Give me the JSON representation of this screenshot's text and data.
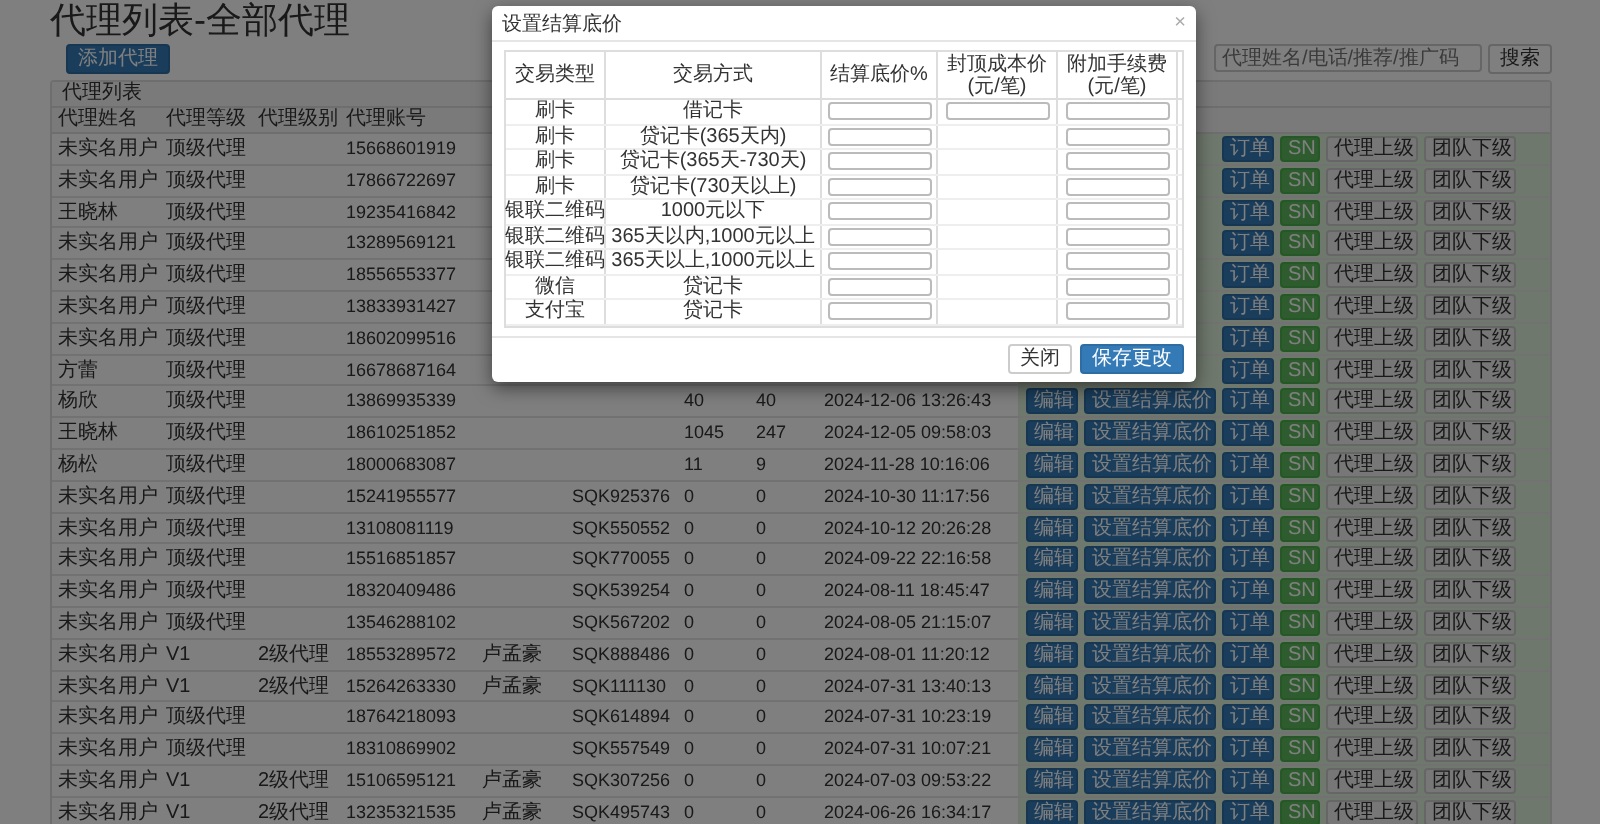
{
  "page": {
    "title": "代理列表-全部代理",
    "add_button": "添加代理",
    "search": {
      "placeholder": "代理姓名/电话/推荐/推广码"
    },
    "search_button": "搜索"
  },
  "panel": {
    "heading": "代理列表",
    "columns": [
      "代理姓名",
      "代理等级",
      "代理级别",
      "代理账号"
    ],
    "rows": [
      {
        "name": "未实名用户",
        "level": "顶级代理",
        "phone": "15668601919",
        "actions": [
          {
            "kind": "order",
            "label": "订单"
          },
          {
            "kind": "sn",
            "label": "SN"
          },
          {
            "kind": "upline",
            "label": "代理上级"
          },
          {
            "kind": "downline",
            "label": "团队下级"
          }
        ]
      },
      {
        "name": "未实名用户",
        "level": "顶级代理",
        "phone": "17866722697",
        "actions": [
          {
            "kind": "order",
            "label": "订单"
          },
          {
            "kind": "sn",
            "label": "SN"
          },
          {
            "kind": "upline",
            "label": "代理上级"
          },
          {
            "kind": "downline",
            "label": "团队下级"
          }
        ]
      },
      {
        "name": "王晓林",
        "level": "顶级代理",
        "phone": "19235416842",
        "actions": [
          {
            "kind": "order",
            "label": "订单"
          },
          {
            "kind": "sn",
            "label": "SN"
          },
          {
            "kind": "upline",
            "label": "代理上级"
          },
          {
            "kind": "downline",
            "label": "团队下级"
          }
        ]
      },
      {
        "name": "未实名用户",
        "level": "顶级代理",
        "phone": "13289569121",
        "actions": [
          {
            "kind": "order",
            "label": "订单"
          },
          {
            "kind": "sn",
            "label": "SN"
          },
          {
            "kind": "upline",
            "label": "代理上级"
          },
          {
            "kind": "downline",
            "label": "团队下级"
          }
        ]
      },
      {
        "name": "未实名用户",
        "level": "顶级代理",
        "phone": "18556553377",
        "actions": [
          {
            "kind": "order",
            "label": "订单"
          },
          {
            "kind": "sn",
            "label": "SN"
          },
          {
            "kind": "upline",
            "label": "代理上级"
          },
          {
            "kind": "downline",
            "label": "团队下级"
          }
        ]
      },
      {
        "name": "未实名用户",
        "level": "顶级代理",
        "phone": "13833931427",
        "actions": [
          {
            "kind": "order",
            "label": "订单"
          },
          {
            "kind": "sn",
            "label": "SN"
          },
          {
            "kind": "upline",
            "label": "代理上级"
          },
          {
            "kind": "downline",
            "label": "团队下级"
          }
        ]
      },
      {
        "name": "未实名用户",
        "level": "顶级代理",
        "phone": "18602099516",
        "actions": [
          {
            "kind": "order",
            "label": "订单"
          },
          {
            "kind": "sn",
            "label": "SN"
          },
          {
            "kind": "upline",
            "label": "代理上级"
          },
          {
            "kind": "downline",
            "label": "团队下级"
          }
        ]
      },
      {
        "name": "方蕾",
        "level": "顶级代理",
        "phone": "16678687164",
        "actions": [
          {
            "kind": "order",
            "label": "订单"
          },
          {
            "kind": "sn",
            "label": "SN"
          },
          {
            "kind": "upline",
            "label": "代理上级"
          },
          {
            "kind": "downline",
            "label": "团队下级"
          }
        ]
      },
      {
        "name": "杨欣",
        "level": "顶级代理",
        "phone": "13869935339",
        "column_7": "40",
        "column_8": "40",
        "column_9": "2024-12-06 13:26:43",
        "actions": [
          {
            "kind": "edit",
            "label": "编辑"
          },
          {
            "kind": "price",
            "label": "设置结算底价"
          },
          {
            "kind": "order",
            "label": "订单"
          },
          {
            "kind": "sn",
            "label": "SN"
          },
          {
            "kind": "upline",
            "label": "代理上级"
          },
          {
            "kind": "downline",
            "label": "团队下级"
          }
        ]
      },
      {
        "name": "王晓林",
        "level": "顶级代理",
        "phone": "18610251852",
        "column_7": "1045",
        "column_8": "247",
        "column_9": "2024-12-05 09:58:03",
        "actions": [
          {
            "kind": "edit",
            "label": "编辑"
          },
          {
            "kind": "price",
            "label": "设置结算底价"
          },
          {
            "kind": "order",
            "label": "订单"
          },
          {
            "kind": "sn",
            "label": "SN"
          },
          {
            "kind": "upline",
            "label": "代理上级"
          },
          {
            "kind": "downline",
            "label": "团队下级"
          }
        ]
      },
      {
        "name": "杨松",
        "level": "顶级代理",
        "phone": "18000683087",
        "column_7": "11",
        "column_8": "9",
        "column_9": "2024-11-28 10:16:06",
        "actions": [
          {
            "kind": "edit",
            "label": "编辑"
          },
          {
            "kind": "price",
            "label": "设置结算底价"
          },
          {
            "kind": "order",
            "label": "订单"
          },
          {
            "kind": "sn",
            "label": "SN"
          },
          {
            "kind": "upline",
            "label": "代理上级"
          },
          {
            "kind": "downline",
            "label": "团队下级"
          }
        ]
      },
      {
        "name": "未实名用户",
        "level": "顶级代理",
        "phone": "15241955577",
        "column_6": "SQK925376",
        "column_7": "0",
        "column_8": "0",
        "column_9": "2024-10-30 11:17:56",
        "actions": [
          {
            "kind": "edit",
            "label": "编辑"
          },
          {
            "kind": "price",
            "label": "设置结算底价"
          },
          {
            "kind": "order",
            "label": "订单"
          },
          {
            "kind": "sn",
            "label": "SN"
          },
          {
            "kind": "upline",
            "label": "代理上级"
          },
          {
            "kind": "downline",
            "label": "团队下级"
          }
        ]
      },
      {
        "name": "未实名用户",
        "level": "顶级代理",
        "phone": "13108081119",
        "column_6": "SQK550552",
        "column_7": "0",
        "column_8": "0",
        "column_9": "2024-10-12 20:26:28",
        "actions": [
          {
            "kind": "edit",
            "label": "编辑"
          },
          {
            "kind": "price",
            "label": "设置结算底价"
          },
          {
            "kind": "order",
            "label": "订单"
          },
          {
            "kind": "sn",
            "label": "SN"
          },
          {
            "kind": "upline",
            "label": "代理上级"
          },
          {
            "kind": "downline",
            "label": "团队下级"
          }
        ]
      },
      {
        "name": "未实名用户",
        "level": "顶级代理",
        "phone": "15516851857",
        "column_6": "SQK770055",
        "column_7": "0",
        "column_8": "0",
        "column_9": "2024-09-22 22:16:58",
        "actions": [
          {
            "kind": "edit",
            "label": "编辑"
          },
          {
            "kind": "price",
            "label": "设置结算底价"
          },
          {
            "kind": "order",
            "label": "订单"
          },
          {
            "kind": "sn",
            "label": "SN"
          },
          {
            "kind": "upline",
            "label": "代理上级"
          },
          {
            "kind": "downline",
            "label": "团队下级"
          }
        ]
      },
      {
        "name": "未实名用户",
        "level": "顶级代理",
        "phone": "18320409486",
        "column_6": "SQK539254",
        "column_7": "0",
        "column_8": "0",
        "column_9": "2024-08-11 18:45:47",
        "actions": [
          {
            "kind": "edit",
            "label": "编辑"
          },
          {
            "kind": "price",
            "label": "设置结算底价"
          },
          {
            "kind": "order",
            "label": "订单"
          },
          {
            "kind": "sn",
            "label": "SN"
          },
          {
            "kind": "upline",
            "label": "代理上级"
          },
          {
            "kind": "downline",
            "label": "团队下级"
          }
        ]
      },
      {
        "name": "未实名用户",
        "level": "顶级代理",
        "phone": "13546288102",
        "column_6": "SQK567202",
        "column_7": "0",
        "column_8": "0",
        "column_9": "2024-08-05 21:15:07",
        "actions": [
          {
            "kind": "edit",
            "label": "编辑"
          },
          {
            "kind": "price",
            "label": "设置结算底价"
          },
          {
            "kind": "order",
            "label": "订单"
          },
          {
            "kind": "sn",
            "label": "SN"
          },
          {
            "kind": "upline",
            "label": "代理上级"
          },
          {
            "kind": "downline",
            "label": "团队下级"
          }
        ]
      },
      {
        "name": "未实名用户",
        "level": "V1",
        "tier": "2级代理",
        "phone": "18553289572",
        "column_5": "卢孟豪",
        "column_6": "SQK888486",
        "column_7": "0",
        "column_8": "0",
        "column_9": "2024-08-01 11:20:12",
        "actions": [
          {
            "kind": "edit",
            "label": "编辑"
          },
          {
            "kind": "price",
            "label": "设置结算底价"
          },
          {
            "kind": "order",
            "label": "订单"
          },
          {
            "kind": "sn",
            "label": "SN"
          },
          {
            "kind": "upline",
            "label": "代理上级"
          },
          {
            "kind": "downline",
            "label": "团队下级"
          }
        ]
      },
      {
        "name": "未实名用户",
        "level": "V1",
        "tier": "2级代理",
        "phone": "15264263330",
        "column_5": "卢孟豪",
        "column_6": "SQK111130",
        "column_7": "0",
        "column_8": "0",
        "column_9": "2024-07-31 13:40:13",
        "actions": [
          {
            "kind": "edit",
            "label": "编辑"
          },
          {
            "kind": "price",
            "label": "设置结算底价"
          },
          {
            "kind": "order",
            "label": "订单"
          },
          {
            "kind": "sn",
            "label": "SN"
          },
          {
            "kind": "upline",
            "label": "代理上级"
          },
          {
            "kind": "downline",
            "label": "团队下级"
          }
        ]
      },
      {
        "name": "未实名用户",
        "level": "顶级代理",
        "phone": "18764218093",
        "column_6": "SQK614894",
        "column_7": "0",
        "column_8": "0",
        "column_9": "2024-07-31 10:23:19",
        "actions": [
          {
            "kind": "edit",
            "label": "编辑"
          },
          {
            "kind": "price",
            "label": "设置结算底价"
          },
          {
            "kind": "order",
            "label": "订单"
          },
          {
            "kind": "sn",
            "label": "SN"
          },
          {
            "kind": "upline",
            "label": "代理上级"
          },
          {
            "kind": "downline",
            "label": "团队下级"
          }
        ]
      },
      {
        "name": "未实名用户",
        "level": "顶级代理",
        "phone": "18310869902",
        "column_6": "SQK557549",
        "column_7": "0",
        "column_8": "0",
        "column_9": "2024-07-31 10:07:21",
        "actions": [
          {
            "kind": "edit",
            "label": "编辑"
          },
          {
            "kind": "price",
            "label": "设置结算底价"
          },
          {
            "kind": "order",
            "label": "订单"
          },
          {
            "kind": "sn",
            "label": "SN"
          },
          {
            "kind": "upline",
            "label": "代理上级"
          },
          {
            "kind": "downline",
            "label": "团队下级"
          }
        ]
      },
      {
        "name": "未实名用户",
        "level": "V1",
        "tier": "2级代理",
        "phone": "15106595121",
        "column_5": "卢孟豪",
        "column_6": "SQK307256",
        "column_7": "0",
        "column_8": "0",
        "column_9": "2024-07-03 09:53:22",
        "actions": [
          {
            "kind": "edit",
            "label": "编辑"
          },
          {
            "kind": "price",
            "label": "设置结算底价"
          },
          {
            "kind": "order",
            "label": "订单"
          },
          {
            "kind": "sn",
            "label": "SN"
          },
          {
            "kind": "upline",
            "label": "代理上级"
          },
          {
            "kind": "downline",
            "label": "团队下级"
          }
        ]
      },
      {
        "name": "未实名用户",
        "level": "V1",
        "tier": "2级代理",
        "phone": "13235321535",
        "column_5": "卢孟豪",
        "column_6": "SQK495743",
        "column_7": "0",
        "column_8": "0",
        "column_9": "2024-06-26 16:34:17",
        "actions": [
          {
            "kind": "edit",
            "label": "编辑"
          },
          {
            "kind": "price",
            "label": "设置结算底价"
          },
          {
            "kind": "order",
            "label": "订单"
          },
          {
            "kind": "sn",
            "label": "SN"
          },
          {
            "kind": "upline",
            "label": "代理上级"
          },
          {
            "kind": "downline",
            "label": "团队下级"
          }
        ]
      }
    ]
  },
  "dialog": {
    "title": "设置结算底价",
    "close": "×",
    "columns": [
      "交易类型",
      "交易方式",
      "结算底价%",
      "封顶成本价(元/笔)",
      "附加手续费(元/笔)"
    ],
    "rows": [
      {
        "type": "刷卡",
        "method": "借记卡",
        "has_cap_field": true
      },
      {
        "type": "刷卡",
        "method": "贷记卡(365天内)",
        "has_cap_field": false
      },
      {
        "type": "刷卡",
        "method": "贷记卡(365天-730天)",
        "has_cap_field": false
      },
      {
        "type": "刷卡",
        "method": "贷记卡(730天以上)",
        "has_cap_field": false
      },
      {
        "type": "银联二维码",
        "method": "1000元以下",
        "has_cap_field": false
      },
      {
        "type": "银联二维码",
        "method": "365天以内,1000元以上",
        "has_cap_field": false
      },
      {
        "type": "银联二维码",
        "method": "365天以上,1000元以上",
        "has_cap_field": false
      },
      {
        "type": "微信",
        "method": "贷记卡",
        "has_cap_field": false
      },
      {
        "type": "支付宝",
        "method": "贷记卡",
        "has_cap_field": false
      }
    ],
    "buttons": [
      {
        "kind": "close",
        "label": "关闭"
      },
      {
        "kind": "save",
        "label": "保存更改"
      }
    ]
  }
}
